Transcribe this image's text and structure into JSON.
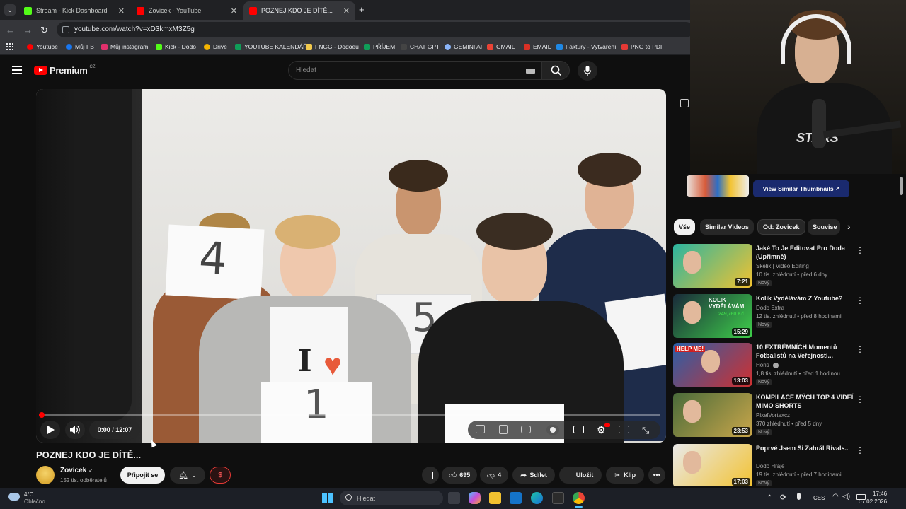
{
  "browser": {
    "tabs": [
      {
        "title": "Stream - Kick Dashboard",
        "color": "#53fc18"
      },
      {
        "title": "Zovicek - YouTube",
        "color": "#ff0000"
      },
      {
        "title": "POZNEJ KDO JE DÍTĚ... - Yo",
        "color": "#ff0000"
      }
    ],
    "new_tab": "+",
    "url": "youtube.com/watch?v=xD3kmxM3Z5g",
    "bookmarks": [
      {
        "label": "Youtube",
        "color": "#ff0000"
      },
      {
        "label": "Můj FB",
        "color": "#1877f2"
      },
      {
        "label": "Můj instagram",
        "color": "#e1306c"
      },
      {
        "label": "Kick - Dodo",
        "color": "#53fc18"
      },
      {
        "label": "Drive",
        "color": "#f4b400"
      },
      {
        "label": "YOUTUBE KALENDÁŘ",
        "color": "#0f9d58"
      },
      {
        "label": "FNGG - Dodoeu",
        "color": "#f2c94c"
      },
      {
        "label": "PŘÍJEM",
        "color": "#0f9d58"
      },
      {
        "label": "CHAT GPT",
        "color": "#444444"
      },
      {
        "label": "GEMINI AI",
        "color": "#8ab4f8"
      },
      {
        "label": "GMAIL",
        "color": "#ea4335"
      },
      {
        "label": "EMAIL",
        "color": "#d93025"
      },
      {
        "label": "Faktury - Vytváření",
        "color": "#1e88e5"
      },
      {
        "label": "PNG to PDF",
        "color": "#e53935"
      }
    ]
  },
  "youtube": {
    "logo_text": "Premium",
    "country": "CZ",
    "search_placeholder": "Hledat",
    "player": {
      "time": "0:00 / 12:07",
      "progress": 0.004
    },
    "video": {
      "title": "POZNEJ KDO JE DÍTĚ...",
      "channel": "Zovicek",
      "verified": "✔",
      "subscribers": "152 tis. odběratelů",
      "join": "Připojit se",
      "likes": "695",
      "dislikes": "4",
      "share": "Sdílet",
      "save": "Uložit",
      "clip": "Klip",
      "card_numbers": [
        "4",
        "5",
        "1"
      ],
      "shirt_text": "I"
    },
    "similar_button": "View Similar Thumbnails",
    "chips": [
      {
        "label": "Vše",
        "selected": true
      },
      {
        "label": "Similar Videos",
        "selected": false
      },
      {
        "label": "Od: Zovicek",
        "selected": false
      },
      {
        "label": "Souvise",
        "selected": false
      }
    ],
    "recommendations": [
      {
        "title": "Jaké To Je Editovat Pro Doda (Upřímně)",
        "channel": "Skelik | Video Editing",
        "meta": "10 tis. zhlédnutí • před 6 dny",
        "badge": "Nový",
        "duration": "7:21",
        "thumb_colors": [
          "#2bb5a0",
          "#f2c230"
        ]
      },
      {
        "title": "Kolik Vydělávám Z Youtube?",
        "channel": "Dodo Extra",
        "meta": "12 tis. zhlédnutí • před 8 hodinami",
        "badge": "Nový",
        "duration": "15:29",
        "thumb_colors": [
          "#1a2a3a",
          "#3ecf4a"
        ],
        "thumb_text": "KOLIK VYDĚLÁVÁM",
        "thumb_sub": "249,760 Kč"
      },
      {
        "title": "10 EXTRÉMNÍCH Momentů Fotbalistů na Veřejnosti...",
        "channel": "Horis",
        "meta": "1,8 tis. zhlédnutí • před 1 hodinou",
        "badge": "Nový",
        "duration": "13:03",
        "thumb_colors": [
          "#2b5fa8",
          "#d03030"
        ],
        "thumb_text": "HELP ME!"
      },
      {
        "title": "KOMPILACE MÝCH TOP 4 VIDEÍ MIMO SHORTS",
        "channel": "PixelVortexcz",
        "meta": "370 zhlédnutí • před 5 dny",
        "badge": "Nový",
        "duration": "23:53",
        "thumb_colors": [
          "#4a6b3a",
          "#c9a64a"
        ]
      },
      {
        "title": "Poprvé Jsem Si Zahrál Rivals..",
        "channel": "Dodo Hraje",
        "meta": "19 tis. zhlédnutí • před 7 hodinami",
        "badge": "Nový",
        "duration": "17:03",
        "thumb_colors": [
          "#e9e9e9",
          "#f2c230"
        ]
      }
    ]
  },
  "webcam": {
    "shirt_text": "STARS"
  },
  "taskbar": {
    "weather_temp": "4°C",
    "weather_text": "Oblačno",
    "search_label": "Hledat",
    "language": "CES",
    "time": "17:46",
    "date": "07.02.2026"
  }
}
